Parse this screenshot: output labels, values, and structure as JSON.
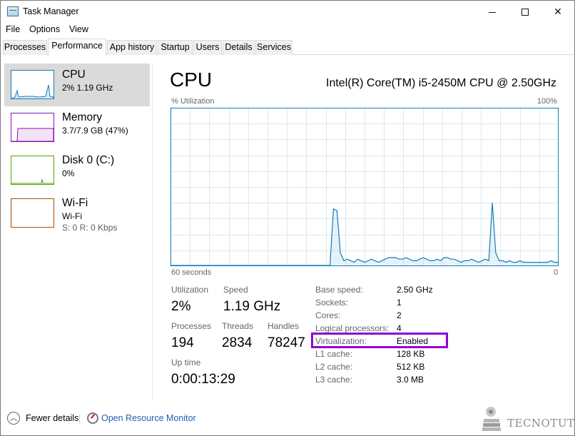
{
  "window": {
    "title": "Task Manager"
  },
  "menu": [
    "File",
    "Options",
    "View"
  ],
  "tabs": [
    "Processes",
    "Performance",
    "App history",
    "Startup",
    "Users",
    "Details",
    "Services"
  ],
  "active_tab": "Performance",
  "resources": [
    {
      "name": "CPU",
      "sub": "2%  1.19 GHz",
      "color": "#117dbb",
      "selected": true
    },
    {
      "name": "Memory",
      "sub": "3.7/7.9 GB (47%)",
      "color": "#8b12ae"
    },
    {
      "name": "Disk 0 (C:)",
      "sub": "0%",
      "color": "#4da60c"
    },
    {
      "name": "Wi-Fi",
      "sub": "Wi-Fi",
      "sub2": "S: 0  R: 0 Kbps",
      "color": "#a74f01"
    }
  ],
  "cpu": {
    "title": "CPU",
    "model": "Intel(R) Core(TM) i5-2450M CPU @ 2.50GHz",
    "util_label": "% Utilization",
    "util_max": "100%",
    "time_left": "60 seconds",
    "time_right": "0"
  },
  "stats": {
    "utilization_label": "Utilization",
    "utilization": "2%",
    "speed_label": "Speed",
    "speed": "1.19 GHz",
    "processes_label": "Processes",
    "processes": "194",
    "threads_label": "Threads",
    "threads": "2834",
    "handles_label": "Handles",
    "handles": "78247",
    "uptime_label": "Up time",
    "uptime": "0:00:13:29"
  },
  "specs": [
    {
      "label": "Base speed:",
      "value": "2.50 GHz"
    },
    {
      "label": "Sockets:",
      "value": "1"
    },
    {
      "label": "Cores:",
      "value": "2"
    },
    {
      "label": "Logical processors:",
      "value": "4"
    },
    {
      "label": "Virtualization:",
      "value": "Enabled"
    },
    {
      "label": "L1 cache:",
      "value": "128 KB"
    },
    {
      "label": "L2 cache:",
      "value": "512 KB"
    },
    {
      "label": "L3 cache:",
      "value": "3.0 MB"
    }
  ],
  "bottom": {
    "fewer_details": "Fewer details",
    "open_resource_monitor": "Open Resource Monitor"
  },
  "watermark": "TECNOTUTO",
  "chart_data": {
    "type": "line",
    "title": "",
    "xlabel": "",
    "ylabel": "% Utilization",
    "ylim": [
      0,
      100
    ],
    "xlim": [
      60,
      0
    ],
    "color": "#117dbb",
    "values": [
      0,
      0,
      0,
      0,
      0,
      0,
      0,
      0,
      0,
      0,
      0,
      0,
      0,
      0,
      0,
      0,
      0,
      0,
      0,
      0,
      0,
      0,
      0,
      0,
      0,
      0,
      0,
      0,
      0,
      0,
      0,
      0,
      0,
      0,
      0,
      0,
      0,
      0,
      0,
      0,
      0,
      0,
      0,
      0,
      0,
      0,
      0,
      36,
      35,
      8,
      3,
      4,
      3,
      2,
      4,
      3,
      2,
      3,
      4,
      3,
      2,
      3,
      4,
      5,
      5,
      5,
      4,
      4,
      5,
      4,
      3,
      3,
      4,
      5,
      4,
      3,
      3,
      4,
      3,
      5,
      5,
      4,
      4,
      3,
      2,
      3,
      3,
      4,
      3,
      2,
      3,
      4,
      3,
      40,
      8,
      3,
      3,
      2,
      3,
      2,
      2,
      3,
      2,
      2,
      2,
      2,
      2,
      2,
      2,
      2,
      3,
      2,
      2
    ]
  }
}
